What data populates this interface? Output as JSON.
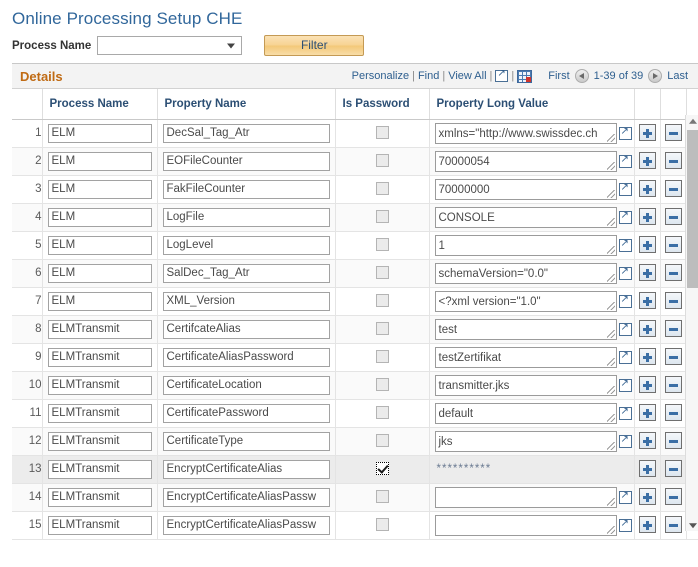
{
  "page": {
    "title": "Online Processing Setup CHE"
  },
  "filter": {
    "process_name_label": "Process Name",
    "process_name_value": "",
    "filter_button_label": "Filter"
  },
  "grid": {
    "title": "Details",
    "actions": {
      "personalize": "Personalize",
      "find": "Find",
      "view_all": "View All",
      "sep": "|",
      "new_window_icon": "new-window-icon",
      "download_icon": "download-grid-icon"
    },
    "pager": {
      "first": "First",
      "prev_icon": "previous-page-icon",
      "range": "1-39 of 39",
      "next_icon": "next-page-icon",
      "last": "Last"
    },
    "columns": {
      "row_number": "",
      "process_name": "Process Name",
      "property_name": "Property Name",
      "is_password": "Is Password",
      "property_long_value": "Property Long Value",
      "add": "",
      "remove": ""
    },
    "row_buttons": {
      "add_label": "add-row-button",
      "remove_label": "delete-row-button"
    },
    "masked_value": "**********",
    "rows": [
      {
        "n": "1",
        "process": "ELM",
        "property": "DecSal_Tag_Atr",
        "is_password": false,
        "value": "xmlns=\"http://www.swissdec.ch",
        "masked": false
      },
      {
        "n": "2",
        "process": "ELM",
        "property": "EOFileCounter",
        "is_password": false,
        "value": "70000054",
        "masked": false
      },
      {
        "n": "3",
        "process": "ELM",
        "property": "FakFileCounter",
        "is_password": false,
        "value": "70000000",
        "masked": false
      },
      {
        "n": "4",
        "process": "ELM",
        "property": "LogFile",
        "is_password": false,
        "value": "CONSOLE",
        "masked": false
      },
      {
        "n": "5",
        "process": "ELM",
        "property": "LogLevel",
        "is_password": false,
        "value": "1",
        "masked": false
      },
      {
        "n": "6",
        "process": "ELM",
        "property": "SalDec_Tag_Atr",
        "is_password": false,
        "value": "schemaVersion=\"0.0\"",
        "masked": false
      },
      {
        "n": "7",
        "process": "ELM",
        "property": "XML_Version",
        "is_password": false,
        "value": "<?xml version=\"1.0\"",
        "masked": false
      },
      {
        "n": "8",
        "process": "ELMTransmit",
        "property": "CertifcateAlias",
        "is_password": false,
        "value": "test",
        "masked": false
      },
      {
        "n": "9",
        "process": "ELMTransmit",
        "property": "CertificateAliasPassword",
        "is_password": false,
        "value": "testZertifikat",
        "masked": false
      },
      {
        "n": "10",
        "process": "ELMTransmit",
        "property": "CertificateLocation",
        "is_password": false,
        "value": "transmitter.jks",
        "masked": false
      },
      {
        "n": "11",
        "process": "ELMTransmit",
        "property": "CertificatePassword",
        "is_password": false,
        "value": "default",
        "masked": false
      },
      {
        "n": "12",
        "process": "ELMTransmit",
        "property": "CertificateType",
        "is_password": false,
        "value": "jks",
        "masked": false
      },
      {
        "n": "13",
        "process": "ELMTransmit",
        "property": "EncryptCertificateAlias",
        "is_password": true,
        "value": "**********",
        "masked": true
      },
      {
        "n": "14",
        "process": "ELMTransmit",
        "property": "EncryptCertificateAliasPassw",
        "is_password": false,
        "value": "",
        "masked": false
      },
      {
        "n": "15",
        "process": "ELMTransmit",
        "property": "EncryptCertificateAliasPassw",
        "is_password": false,
        "value": "",
        "masked": false
      }
    ]
  },
  "colors": {
    "title_blue": "#31679b",
    "grid_title_orange": "#c06b14",
    "link_blue": "#2e5f8f",
    "filter_button": "#f3c878",
    "selected_row": "#ececec"
  }
}
